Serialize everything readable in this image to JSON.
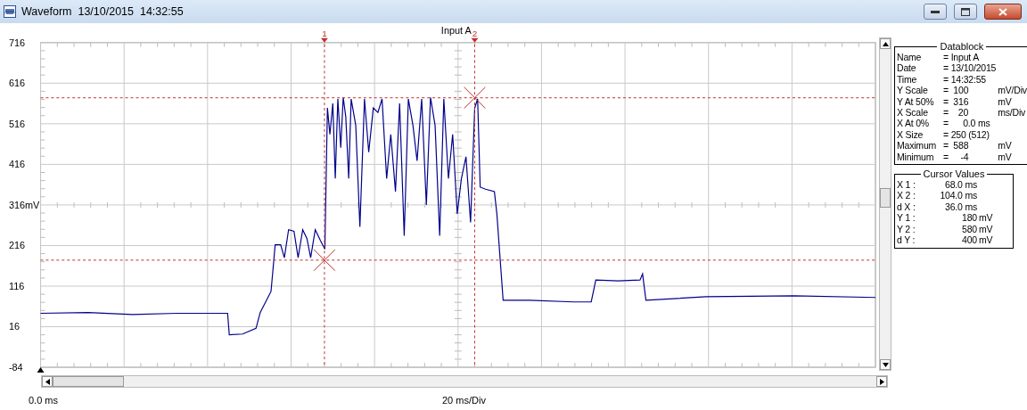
{
  "window": {
    "title": "Waveform  13/10/2015  14:32:55"
  },
  "scope": {
    "title": "Input A",
    "y_labels": [
      "716",
      "616",
      "516",
      "416",
      "316mV",
      "216",
      "116",
      "16",
      "-84"
    ],
    "x_start_label": "0.0 ms",
    "x_scale_label": "20 ms/Div",
    "cursors": [
      {
        "label": "1"
      },
      {
        "label": "2"
      }
    ]
  },
  "datablock": {
    "title": "Datablock",
    "rows": [
      {
        "label": "Name",
        "value": "= Input A"
      },
      {
        "label": "Date",
        "value": "= 13/10/2015"
      },
      {
        "label": "Time",
        "value": "= 14:32:55"
      },
      {
        "label": "Y Scale",
        "value": "=  100",
        "unit": "mV/Div"
      },
      {
        "label": "Y At 50%",
        "value": "=  316",
        "unit": "mV"
      },
      {
        "label": "X Scale",
        "value": "=    20",
        "unit": "ms/Div"
      },
      {
        "label": "X At 0%",
        "value": "=      0.0 ms"
      },
      {
        "label": "X Size",
        "value": "= 250 (512)"
      },
      {
        "label": "Maximum",
        "value": "=  588",
        "unit": "mV"
      },
      {
        "label": "Minimum",
        "value": "=     -4",
        "unit": "mV"
      }
    ]
  },
  "cursor_values": {
    "title": "Cursor Values",
    "rows": [
      {
        "label": "X 1 :",
        "value": "68.0 ms"
      },
      {
        "label": "X 2 :",
        "value": "104.0 ms"
      },
      {
        "label": "d X :",
        "value": "36.0 ms"
      },
      {
        "label": "Y 1 :",
        "value": "180",
        "unit": "mV"
      },
      {
        "label": "Y 2 :",
        "value": "580",
        "unit": "mV"
      },
      {
        "label": "d Y :",
        "value": "400",
        "unit": "mV"
      }
    ]
  }
}
